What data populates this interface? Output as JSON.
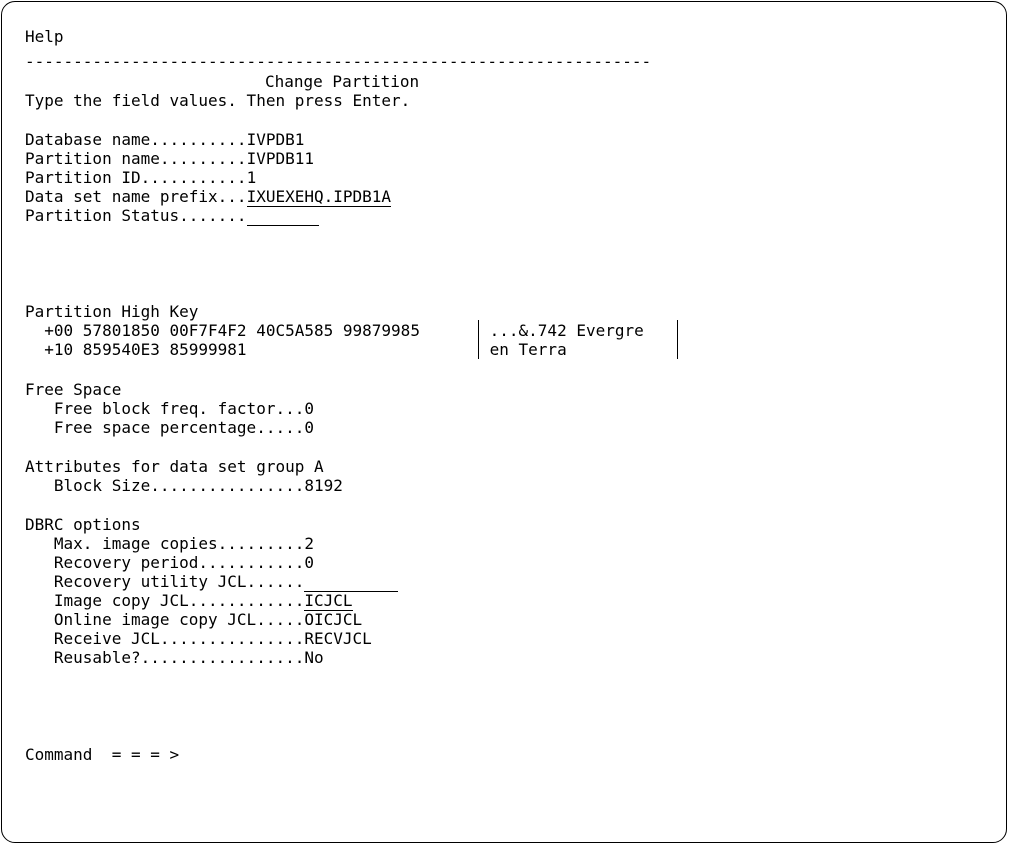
{
  "menu": {
    "help": "Help"
  },
  "separator": "-----------------------------------------------------------------",
  "panel": {
    "title": "Change Partition",
    "instruction": "Type the field values. Then press Enter."
  },
  "fields": {
    "database_name": {
      "label": "Database name..........",
      "value": "IVPDB1"
    },
    "partition_name": {
      "label": "Partition name.........",
      "value": "IVPDB11"
    },
    "partition_id": {
      "label": "Partition ID...........",
      "value": "1"
    },
    "dsn_prefix": {
      "label": "Data set name prefix...",
      "value": "IXUEXEHQ.IPDB1A"
    },
    "partition_status": {
      "label": "Partition Status.......",
      "value": ""
    }
  },
  "high_key": {
    "heading": "Partition High Key",
    "rows": [
      {
        "hex": "  +00 57801850 00F7F4F2 40C5A585 99879985",
        "chars": " ...&.742 Evergre"
      },
      {
        "hex": "  +10 859540E3 85999981",
        "chars": " en Terra"
      }
    ]
  },
  "free_space": {
    "heading": "Free Space",
    "block_freq": {
      "label": "   Free block freq. factor...",
      "value": "0"
    },
    "space_pct": {
      "label": "   Free space percentage.....",
      "value": "0"
    }
  },
  "attributes": {
    "heading": "Attributes for data set group A",
    "block_size": {
      "label": "   Block Size................",
      "value": "8192"
    }
  },
  "dbrc": {
    "heading": "DBRC options",
    "max_image_copies": {
      "label": "   Max. image copies.........",
      "value": "2"
    },
    "recovery_period": {
      "label": "   Recovery period...........",
      "value": "0"
    },
    "recovery_utility_jcl": {
      "label": "   Recovery utility JCL......",
      "value": ""
    },
    "image_copy_jcl": {
      "label": "   Image copy JCL............",
      "value": "ICJCL"
    },
    "online_image_copy_jcl": {
      "label": "   Online image copy JCL.....",
      "value": "OICJCL"
    },
    "receive_jcl": {
      "label": "   Receive JCL...............",
      "value": "RECVJCL"
    },
    "reusable": {
      "label": "   Reusable?.................",
      "value": "No"
    }
  },
  "command": {
    "label": "Command  = = = >",
    "value": ""
  }
}
